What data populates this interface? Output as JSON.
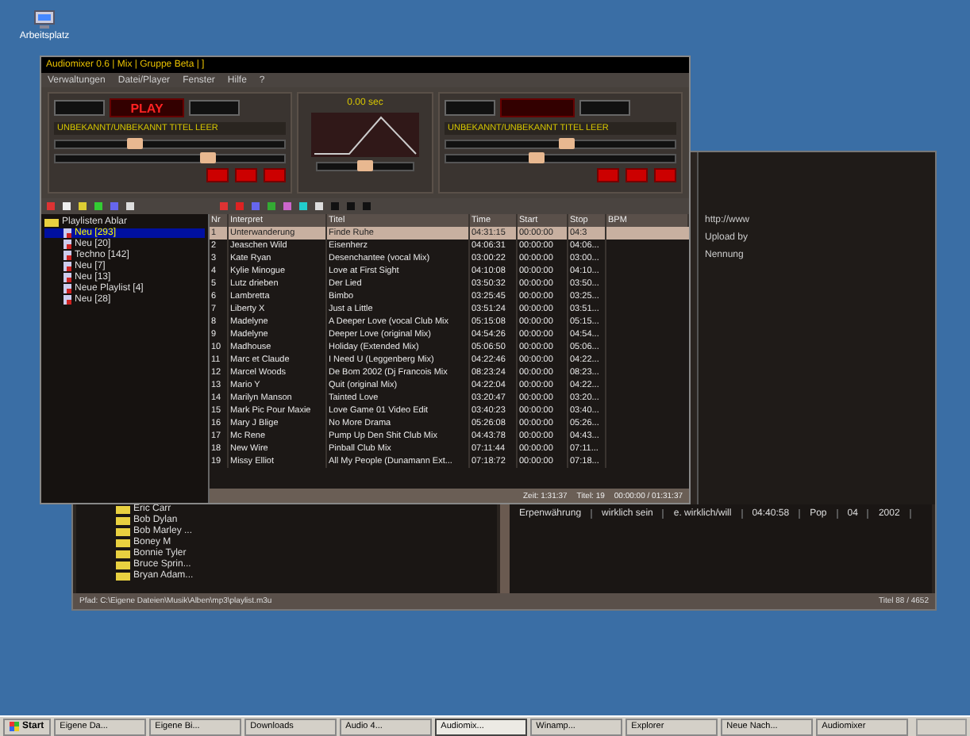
{
  "desktop_icon": {
    "label": "Arbeitsplatz"
  },
  "back_window": {
    "info_lines": [
      "http://www",
      "Upload by",
      "Nennung"
    ],
    "tree": [
      "Eric Carr",
      "Bob Dylan",
      "Bob Marley ...",
      "Boney M",
      "Bonnie Tyler",
      "Bruce Sprin...",
      "Bryan Adam..."
    ],
    "row": [
      "Erpenwährung",
      "wirklich sein",
      "e. wirklich/will",
      "04:40:58",
      "Pop",
      "04",
      "2002"
    ],
    "status": "Pfad: C:\\Eigene Dateien\\Musik\\Alben\\mp3\\playlist.m3u",
    "status_right": "Titel 88 / 4652"
  },
  "window": {
    "title": "Audiomixer 0.6 | Mix | Gruppe Beta | ]",
    "menu": [
      "Verwaltungen",
      "Datei/Player",
      "Fenster",
      "Hilfe",
      "?"
    ]
  },
  "decks": [
    {
      "display": "PLAY",
      "track": "UNBEKANNT/UNBEKANNT TITEL LEER",
      "sliders": [
        {
          "level": 0.35
        },
        {
          "level": 0.7
        }
      ]
    },
    {
      "track": "UNBEKANNT/UNBEKANNT TITEL LEER",
      "sliders": [
        {
          "level": 0.55
        },
        {
          "level": 0.4
        }
      ]
    }
  ],
  "mixer": {
    "reading": "0.00 sec",
    "crossfader": {
      "level": 0.5
    }
  },
  "tree": {
    "root": "Playlisten Ablar",
    "items": [
      {
        "label": "Neu [293]",
        "selected": true
      },
      {
        "label": "Neu [20]",
        "selected": false
      },
      {
        "label": "Techno [142]",
        "selected": false
      },
      {
        "label": "Neu [7]",
        "selected": false
      },
      {
        "label": "Neu [13]",
        "selected": false
      },
      {
        "label": "Neue Playlist [4]",
        "selected": false
      },
      {
        "label": "Neu [28]",
        "selected": false
      }
    ]
  },
  "table": {
    "columns": [
      "Nr",
      "Interpret",
      "Titel",
      "Time",
      "Start",
      "Stop",
      "BPM"
    ],
    "rows": [
      {
        "cells": [
          "1",
          "Unterwanderung",
          "Finde Ruhe",
          "04:31:15",
          "00:00:00",
          "04:3"
        ],
        "selected": true
      },
      {
        "cells": [
          "2",
          "Jeaschen Wild",
          "Eisenherz",
          "04:06:31",
          "00:00:00",
          "04:06..."
        ],
        "selected": false
      },
      {
        "cells": [
          "3",
          "Kate Ryan",
          "Desenchantee (vocal Mix)",
          "03:00:22",
          "00:00:00",
          "03:00..."
        ],
        "selected": false
      },
      {
        "cells": [
          "4",
          "Kylie Minogue",
          "Love at First Sight",
          "04:10:08",
          "00:00:00",
          "04:10..."
        ],
        "selected": false
      },
      {
        "cells": [
          "5",
          "Lutz drieben",
          "Der Lied",
          "03:50:32",
          "00:00:00",
          "03:50..."
        ],
        "selected": false
      },
      {
        "cells": [
          "6",
          "Lambretta",
          "Bimbo",
          "03:25:45",
          "00:00:00",
          "03:25..."
        ],
        "selected": false
      },
      {
        "cells": [
          "7",
          "Liberty X",
          "Just a Little",
          "03:51:24",
          "00:00:00",
          "03:51..."
        ],
        "selected": false
      },
      {
        "cells": [
          "8",
          "Madelyne",
          "A Deeper Love (vocal Club Mix",
          "05:15:08",
          "00:00:00",
          "05:15..."
        ],
        "selected": false
      },
      {
        "cells": [
          "9",
          "Madelyne",
          "Deeper Love (original Mix)",
          "04:54:26",
          "00:00:00",
          "04:54..."
        ],
        "selected": false
      },
      {
        "cells": [
          "10",
          "Madhouse",
          "Holiday (Extended Mix)",
          "05:06:50",
          "00:00:00",
          "05:06..."
        ],
        "selected": false
      },
      {
        "cells": [
          "11",
          "Marc et Claude",
          "I Need U (Leggenberg Mix)",
          "04:22:46",
          "00:00:00",
          "04:22..."
        ],
        "selected": false
      },
      {
        "cells": [
          "12",
          "Marcel Woods",
          "De Bom 2002 (Dj Francois Mix",
          "08:23:24",
          "00:00:00",
          "08:23..."
        ],
        "selected": false
      },
      {
        "cells": [
          "13",
          "Mario Y",
          "Quit (original Mix)",
          "04:22:04",
          "00:00:00",
          "04:22..."
        ],
        "selected": false
      },
      {
        "cells": [
          "14",
          "Marilyn Manson",
          "Tainted Love",
          "03:20:47",
          "00:00:00",
          "03:20..."
        ],
        "selected": false
      },
      {
        "cells": [
          "15",
          "Mark Pic Pour Maxie",
          "Love Game 01 Video Edit",
          "03:40:23",
          "00:00:00",
          "03:40..."
        ],
        "selected": false
      },
      {
        "cells": [
          "16",
          "Mary J Blige",
          "No More Drama",
          "05:26:08",
          "00:00:00",
          "05:26..."
        ],
        "selected": false
      },
      {
        "cells": [
          "17",
          "Mc Rene",
          "Pump Up Den Shit Club Mix",
          "04:43:78",
          "00:00:00",
          "04:43..."
        ],
        "selected": false
      },
      {
        "cells": [
          "18",
          "New Wire",
          "Pinball Club Mix",
          "07:11:44",
          "00:00:00",
          "07:11..."
        ],
        "selected": false
      },
      {
        "cells": [
          "19",
          "Missy Elliot",
          "All My People (Dunamann Ext...",
          "07:18:72",
          "00:00:00",
          "07:18..."
        ],
        "selected": false
      }
    ],
    "status": [
      "Zeit: 1:31:37",
      "Titel: 19",
      "00:00:00 / 01:31:37"
    ]
  },
  "taskbar": {
    "start": "Start",
    "tasks": [
      {
        "label": "Eigene Da...",
        "selected": false
      },
      {
        "label": "Eigene Bi...",
        "selected": false
      },
      {
        "label": "Downloads",
        "selected": false
      },
      {
        "label": "Audio 4...",
        "selected": false
      },
      {
        "label": "Audiomix...",
        "selected": true
      },
      {
        "label": "Winamp...",
        "selected": false
      },
      {
        "label": "Explorer",
        "selected": false
      },
      {
        "label": "Neue Nach...",
        "selected": false
      },
      {
        "label": "Audiomixer",
        "selected": false
      }
    ]
  }
}
